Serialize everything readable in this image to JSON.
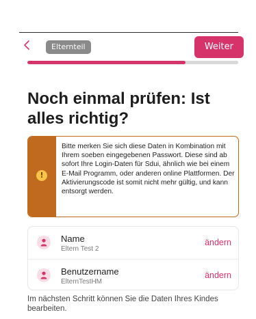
{
  "header": {
    "breadcrumb": "Elternteil",
    "next_label": "Weiter"
  },
  "progress": {
    "fraction": 0.75
  },
  "title": "Noch einmal prüfen: Ist alles richtig?",
  "notice": {
    "icon": "exclamation-icon",
    "text": "Bitte merken Sie sich diese Daten in Kombination mit Ihrem soeben eingegebenen Passwort. Diese sind ab sofort Ihre Login-Daten für Sdui, ähnlich wie bei einem E-Mail Programm, oder anderen online Plattformen. Der Aktivierungscode ist somit nicht mehr gültig, und kann entsorgt werden."
  },
  "details": [
    {
      "label": "Name",
      "value": "Eltern Test 2",
      "action": "ändern"
    },
    {
      "label": "Benutzername",
      "value": "ElternTestHM",
      "action": "ändern"
    }
  ],
  "footer": "Im nächsten Schritt können Sie die Daten Ihres Kindes bearbeiten.",
  "colors": {
    "accent": "#d6336b",
    "warning": "#bf6a1f",
    "warning_icon": "#f7c447"
  }
}
